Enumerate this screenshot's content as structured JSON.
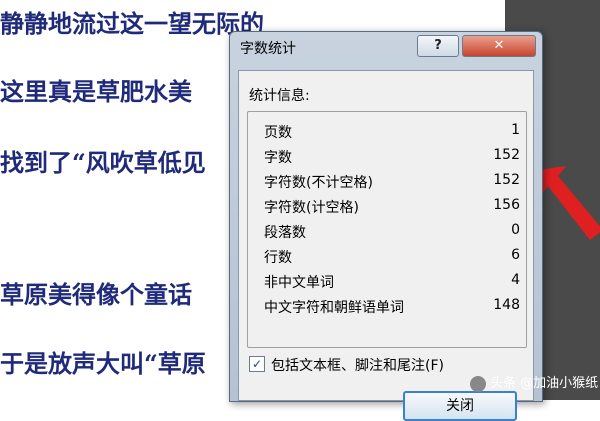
{
  "document": {
    "lines": [
      "静静地流过这一望无际的",
      "这里真是草肥水美",
      "找到了“风吹草低见",
      "草原美得像个童话",
      "于是放声大叫“草原"
    ]
  },
  "dialog": {
    "title": "字数统计",
    "help_label": "?",
    "close_icon_label": "✕",
    "section_label": "统计信息:",
    "stats": [
      {
        "label": "页数",
        "value": "1"
      },
      {
        "label": "字数",
        "value": "152"
      },
      {
        "label": "字符数(不计空格)",
        "value": "152"
      },
      {
        "label": "字符数(计空格)",
        "value": "156"
      },
      {
        "label": "段落数",
        "value": "0"
      },
      {
        "label": "行数",
        "value": "6"
      },
      {
        "label": "非中文单词",
        "value": "4"
      },
      {
        "label": "中文字符和朝鲜语单词",
        "value": "148"
      }
    ],
    "checkbox": {
      "checked": true,
      "mark": "✓",
      "label": "包括文本框、脚注和尾注(F)"
    },
    "close_button_label": "关闭"
  },
  "watermark": "头条 @加油小猴纸",
  "colors": {
    "doc_text": "#1f2a7a",
    "arrow": "#e02020",
    "close_title_button": "#c8452f"
  }
}
